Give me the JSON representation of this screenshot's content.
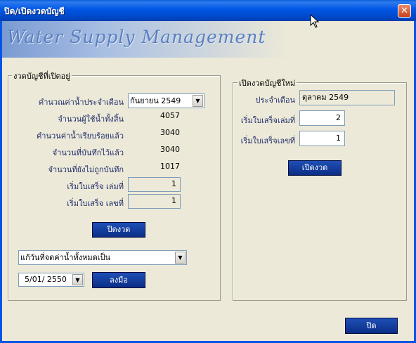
{
  "window": {
    "title": "ปิด/เปิดงวดบัญชี",
    "close_glyph": "✕"
  },
  "banner": {
    "title": "Water Supply Management"
  },
  "left_group": {
    "legend": "งวดบัญชีที่เปิดอยู่",
    "period_label": "คำนวณค่าน้ำประจำเดือน",
    "period_value": "กันยายน 2549",
    "rows": [
      {
        "label": "จำนวนผู้ใช้น้ำทั้งสิ้น",
        "value": "4057"
      },
      {
        "label": "คำนวนค่าน้ำเรียบร้อยแล้ว",
        "value": "3040"
      },
      {
        "label": "จำนวนที่บันทึกไว้แล้ว",
        "value": "3040"
      },
      {
        "label": "จำนวนที่ยังไม่ถูกบันทึก",
        "value": "1017"
      }
    ],
    "receipt_book_label": "เริ่มใบเสร็จ เล่มที่",
    "receipt_book_value": "1",
    "receipt_no_label": "เริ่มใบเสร็จ เลขที่",
    "receipt_no_value": "1",
    "close_period_button": "ปิดงวด",
    "due_date_combo": "แก้วันที่จดค่าน้ำทั้งหมดเป็น",
    "date_value": "5/01/ 2550",
    "record_button": "ลงมือ"
  },
  "right_group": {
    "legend": "เปิดงวดบัญชีใหม่",
    "month_label": "ประจำเดือน",
    "month_value": "ตุลาคม 2549",
    "book_label": "เริ่มใบเสร็จเล่มที่",
    "book_value": "2",
    "no_label": "เริ่มใบเสร็จเลขที่",
    "no_value": "1",
    "open_period_button": "เปิดงวด"
  },
  "footer": {
    "close_button": "ปิด"
  }
}
